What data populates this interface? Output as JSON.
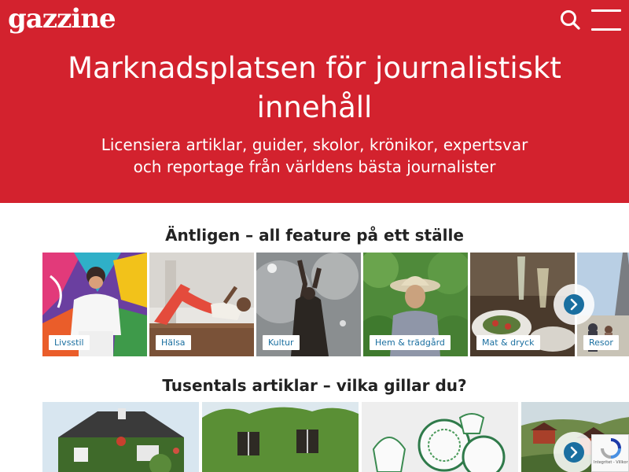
{
  "header": {
    "logo": "gazzine",
    "search_icon": "search-icon",
    "menu_icon": "hamburger-menu-icon"
  },
  "hero": {
    "title_line1": "Marknadsplatsen för journalistiskt",
    "title_line2": "innehåll",
    "subtitle_line1": "Licensiera artiklar, guider, skolor, krönikor, expertsvar",
    "subtitle_line2": "och reportage från världens bästa journalister",
    "background_color": "#d3222e"
  },
  "feature_section": {
    "title": "Äntligen – all feature på ett ställe",
    "categories": [
      {
        "label": "Livsstil"
      },
      {
        "label": "Hälsa"
      },
      {
        "label": "Kultur"
      },
      {
        "label": "Hem & trädgård"
      },
      {
        "label": "Mat & dryck"
      },
      {
        "label": "Resor"
      }
    ],
    "next_icon": "chevron-right-icon"
  },
  "articles_section": {
    "title": "Tusentals artiklar – vilka gillar du?",
    "next_icon": "chevron-right-icon"
  },
  "recaptcha": {
    "text": "Integritet - Villkor"
  },
  "colors": {
    "accent": "#1a6fa0",
    "brand_red": "#d3222e"
  }
}
